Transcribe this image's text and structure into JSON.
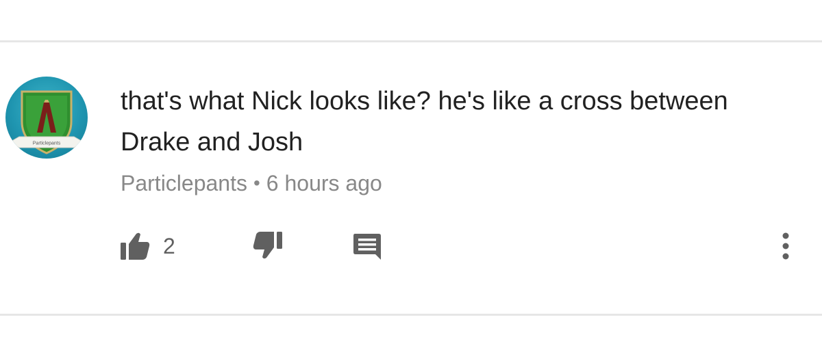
{
  "comment": {
    "text": "that's what Nick looks like? he's like a cross between Drake and Josh",
    "author": "Particlepants",
    "separator": "•",
    "time": "6 hours ago",
    "avatar_banner": "Particlepants"
  },
  "actions": {
    "like_count": "2",
    "like_icon": "thumb-up-icon",
    "dislike_icon": "thumb-down-icon",
    "reply_icon": "comment-reply-icon",
    "more_icon": "more-vertical-icon"
  },
  "colors": {
    "text": "#212121",
    "meta": "#888888",
    "icon": "#606060",
    "divider": "#e6e6e6"
  }
}
